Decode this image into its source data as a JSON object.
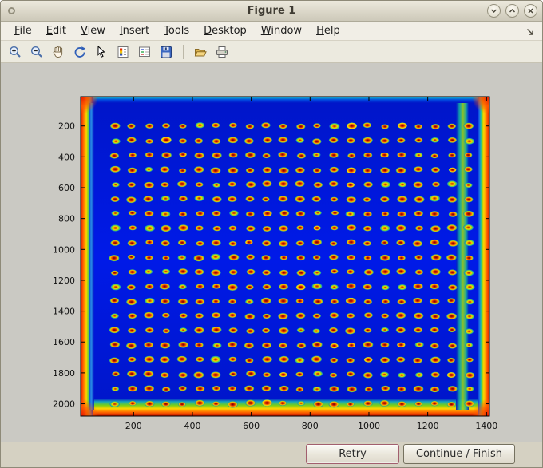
{
  "window": {
    "title": "Figure 1"
  },
  "menubar": {
    "items": [
      "File",
      "Edit",
      "View",
      "Insert",
      "Tools",
      "Desktop",
      "Window",
      "Help"
    ]
  },
  "toolbar": {
    "tools": [
      "zoom-in",
      "zoom-out",
      "pan",
      "rotate-3d",
      "data-cursor",
      "insert-colorbar",
      "insert-legend",
      "save-figure",
      "open-file",
      "print-figure"
    ]
  },
  "actions": {
    "retry": "Retry",
    "continue": "Continue / Finish"
  },
  "chart_data": {
    "type": "heatmap",
    "title": "",
    "description": "Pseudocolor (jet colormap) image of a scanned microarray plate: regular grid of red/orange spots on a deep blue background with saturated red/orange/yellow/green edges",
    "x_ticks": [
      200,
      400,
      600,
      800,
      1000,
      1200,
      1400
    ],
    "y_ticks": [
      200,
      400,
      600,
      800,
      1000,
      1200,
      1400,
      1600,
      1800,
      2000
    ],
    "xlim": [
      20,
      1410
    ],
    "ylim": [
      10,
      2080
    ],
    "y_direction": "reverse",
    "grid": false,
    "spot_grid": {
      "rows": 20,
      "cols": 22,
      "x_start": 137,
      "x_step": 57.3,
      "y_start": 200,
      "y_step": 94.7,
      "spot_rx": 15,
      "spot_ry": 18
    },
    "colors": {
      "background_blue": "#0016c8",
      "spot_center_red": "#6e0400",
      "spot_mid_orange": "#f05800",
      "spot_halo_yellow": "#ffc400",
      "edge_red": "#c81800"
    }
  }
}
